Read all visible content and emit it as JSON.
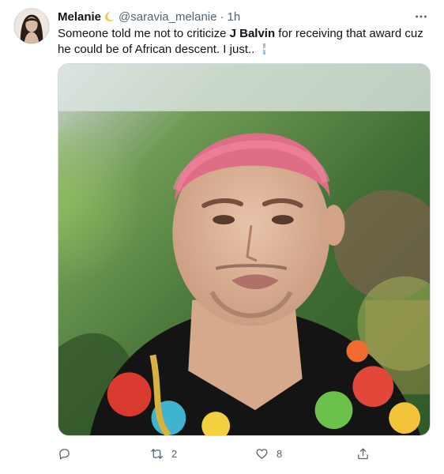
{
  "tweet": {
    "author_name": "Melanie",
    "author_handle": "@saravia_melanie",
    "separator": "·",
    "time": "1h",
    "text_before": "Someone told me not to criticize ",
    "text_bold": "J Balvin",
    "text_after": " for receiving that award cuz he could be of African descent. I just..",
    "actions": {
      "reply_count": "",
      "retweet_count": "2",
      "like_count": "8"
    }
  },
  "icons": {
    "moon": "crescent-moon-emoji",
    "flag": "flag-emoji",
    "more": "more-horizontal-icon",
    "reply": "reply-icon",
    "retweet": "retweet-icon",
    "like": "heart-icon",
    "share": "share-icon"
  },
  "colors": {
    "text": "#0f1419",
    "secondary": "#536471",
    "border": "#cfd9de"
  }
}
